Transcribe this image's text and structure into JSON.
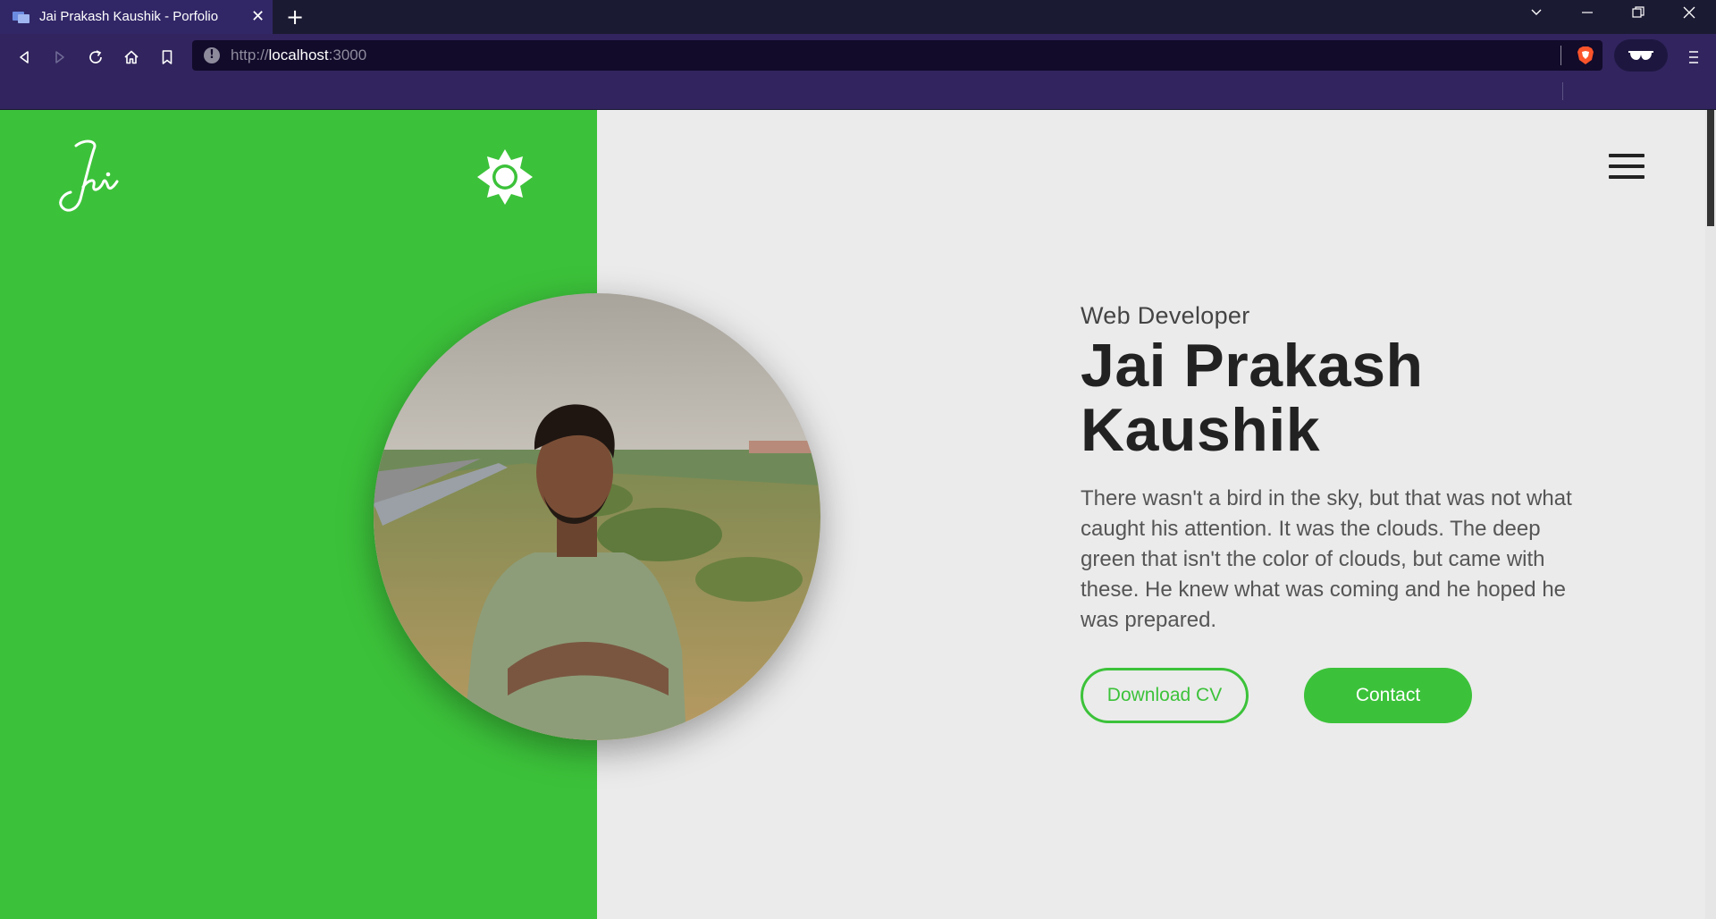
{
  "browser": {
    "tab_title": "Jai Prakash Kaushik - Porfolio",
    "tab_close_glyph": "✕",
    "new_tab_glyph": "+",
    "window_buttons": {
      "list": "⌄",
      "minimize": "—",
      "restore": "❐",
      "close": "✕"
    },
    "url": {
      "scheme": "http://",
      "host": "localhost",
      "port": ":3000"
    },
    "icons": [
      "back-icon",
      "forward-icon",
      "reload-icon",
      "home-icon",
      "bookmark-icon",
      "site-info-icon",
      "brave-shields-icon",
      "extension-icon",
      "menu-icon"
    ],
    "colors": {
      "tabbar": "#1b1a33",
      "active_tab": "#312767",
      "toolbar": "#32245e",
      "urlbar": "#120b2a"
    }
  },
  "page": {
    "logo_text": "Jai",
    "theme_toggle_icon": "sun-icon",
    "menu_icon": "hamburger-icon",
    "hero": {
      "role": "Web Developer",
      "name_line1": "Jai Prakash",
      "name_line2": "Kaushik",
      "description": "There wasn't a bird in the sky, but that was not what caught his attention. It was the clouds. The deep green that isn't the color of clouds, but came with these. He knew what was coming and he hoped he was prepared.",
      "download_cv_label": "Download CV",
      "contact_label": "Contact"
    },
    "colors": {
      "accent_green": "#3cc23a",
      "background": "#ebebeb",
      "heading": "#222222",
      "body_text": "#555555"
    }
  }
}
